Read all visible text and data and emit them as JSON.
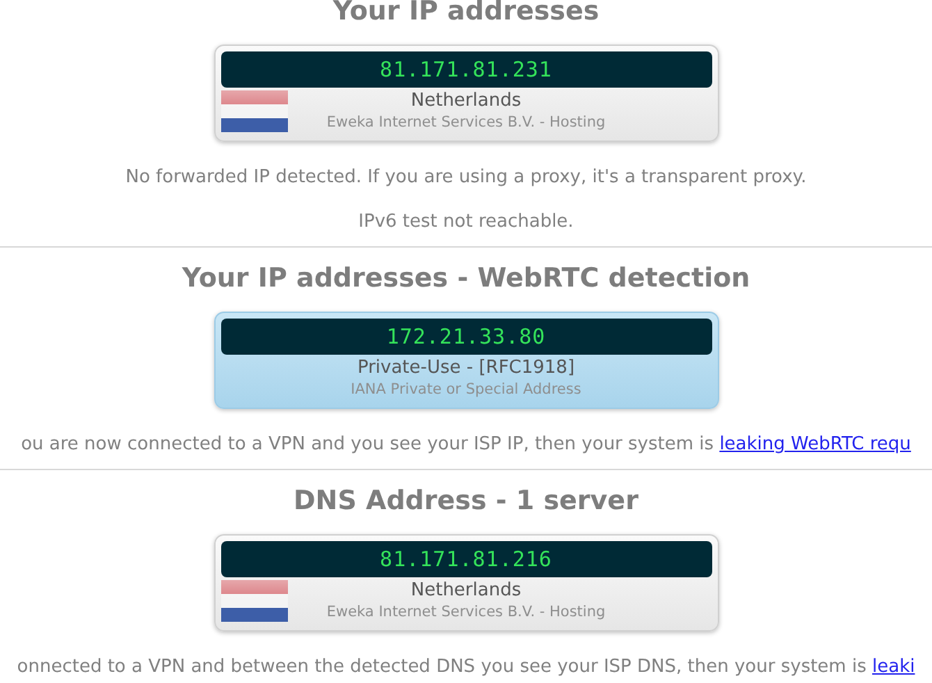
{
  "sections": [
    {
      "title": "Your IP addresses",
      "cards": [
        {
          "kind": "country",
          "ip": "81.171.81.231",
          "name": "Netherlands",
          "detail": "Eweka Internet Services B.V. - Hosting"
        }
      ],
      "notes": [
        {
          "text": "No forwarded IP detected. If you are using a proxy, it's a transparent proxy."
        },
        {
          "text": "IPv6 test not reachable."
        }
      ]
    },
    {
      "title": "Your IP addresses - WebRTC detection",
      "cards": [
        {
          "kind": "private",
          "ip": "172.21.33.80",
          "name": "Private-Use - [RFC1918]",
          "detail": "IANA Private or Special Address"
        }
      ],
      "notes": [
        {
          "text": "ou are now connected to a VPN and you see your ISP IP, then your system is ",
          "link": "leaking WebRTC requ"
        }
      ]
    },
    {
      "title": "DNS Address - 1 server",
      "cards": [
        {
          "kind": "country",
          "ip": "81.171.81.216",
          "name": "Netherlands",
          "detail": "Eweka Internet Services B.V. - Hosting"
        }
      ],
      "notes": [
        {
          "text": "onnected to a VPN and between the detected DNS you see your ISP DNS, then your system is ",
          "link": "leaki"
        }
      ]
    }
  ]
}
